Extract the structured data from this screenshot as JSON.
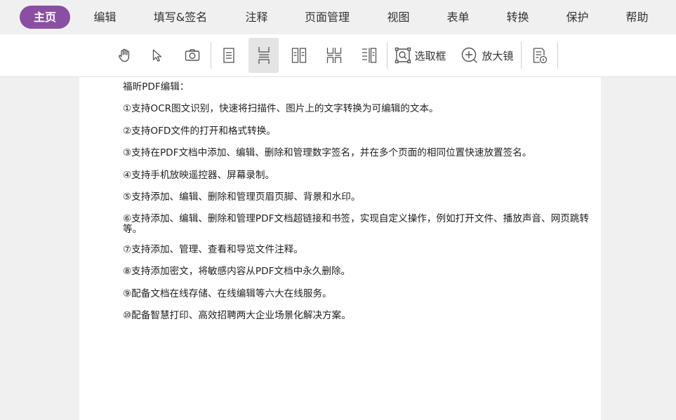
{
  "menu": {
    "items": [
      {
        "label": "主页"
      },
      {
        "label": "编辑"
      },
      {
        "label": "填写&签名"
      },
      {
        "label": "注释"
      },
      {
        "label": "页面管理"
      },
      {
        "label": "视图"
      },
      {
        "label": "表单"
      },
      {
        "label": "转换"
      },
      {
        "label": "保护"
      },
      {
        "label": "帮助"
      }
    ],
    "active_color": "#8a4fa3"
  },
  "toolbar": {
    "marquee_label": "选取框",
    "magnifier_label": "放大镜",
    "selected_tool": "continuous-page-icon"
  },
  "document": {
    "heading": "福昕PDF编辑：",
    "lines": [
      "①支持OCR图文识别，快速将扫描件、图片上的文字转换为可编辑的文本。",
      "②支持OFD文件的打开和格式转换。",
      "③支持在PDF文档中添加、编辑、删除和管理数字签名，并在多个页面的相同位置快速放置签名。",
      "④支持手机放映遥控器、屏幕录制。",
      "⑤支持添加、编辑、删除和管理页眉页脚、背景和水印。",
      "⑥支持添加、编辑、删除和管理PDF文档超链接和书签，实现自定义操作，例如打开文件、播放声音、网页跳转等。",
      "⑦支持添加、管理、查看和导览文件注释。",
      "⑧支持添加密文，将敏感内容从PDF文档中永久删除。",
      "⑨配备文档在线存储、在线编辑等六大在线服务。",
      "⑩配备智慧打印、高效招聘两大企业场景化解决方案。"
    ]
  }
}
